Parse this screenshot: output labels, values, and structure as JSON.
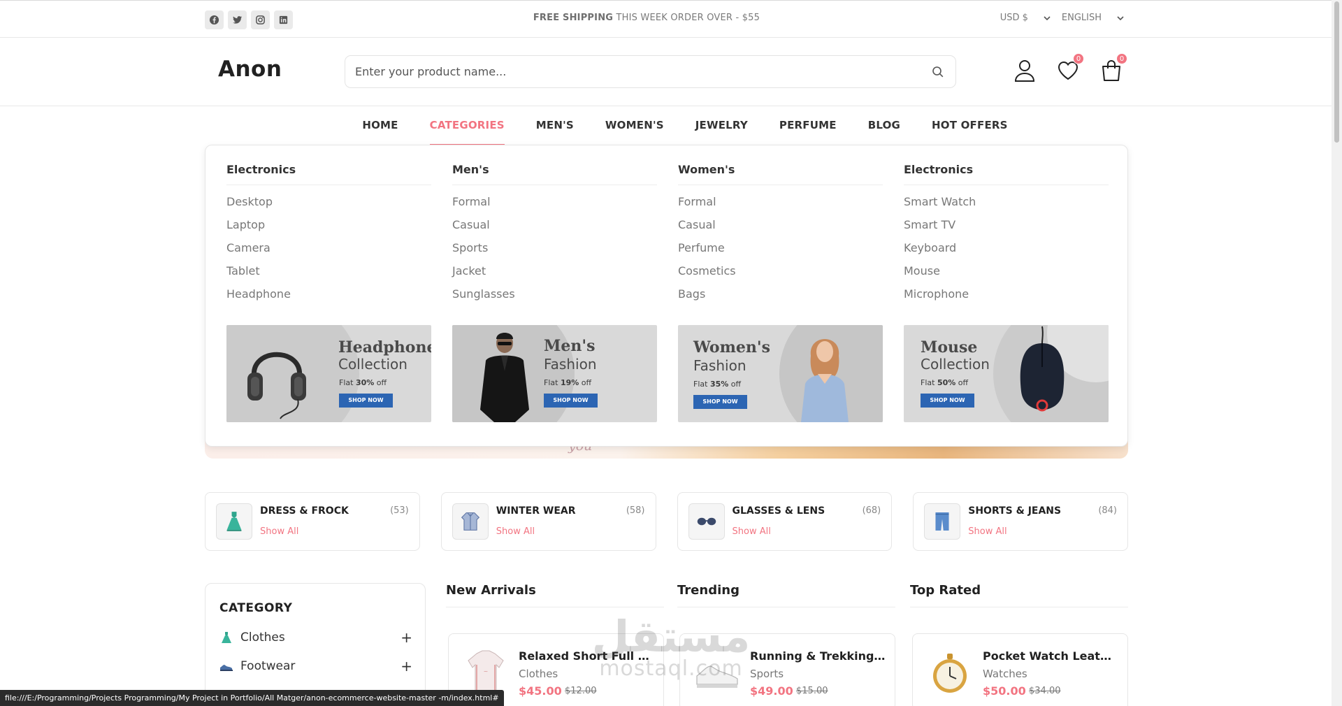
{
  "topbar": {
    "social_icons": [
      "facebook-icon",
      "twitter-icon",
      "instagram-icon",
      "linkedin-icon"
    ],
    "shipping_prefix": "FREE SHIPPING",
    "shipping_suffix": " THIS WEEK ORDER OVER - $55",
    "currency": "USD $",
    "language": "ENGLISH"
  },
  "header": {
    "logo": "Anon",
    "search_placeholder": "Enter your product name...",
    "wishlist_count": "0",
    "cart_count": "0"
  },
  "nav": {
    "items": [
      "HOME",
      "CATEGORIES",
      "MEN'S",
      "WOMEN'S",
      "JEWELRY",
      "PERFUME",
      "BLOG",
      "HOT OFFERS"
    ],
    "active": "CATEGORIES"
  },
  "dropdown": {
    "columns": [
      {
        "title": "Electronics",
        "links": [
          "Desktop",
          "Laptop",
          "Camera",
          "Tablet",
          "Headphone"
        ],
        "promo": {
          "title": "Headphone",
          "subtitle": "Collection",
          "flat_prefix": "Flat ",
          "discount": "30%",
          "flat_suffix": " off",
          "button": "SHOP NOW"
        }
      },
      {
        "title": "Men's",
        "links": [
          "Formal",
          "Casual",
          "Sports",
          "Jacket",
          "Sunglasses"
        ],
        "promo": {
          "title": "Men's",
          "subtitle": "Fashion",
          "flat_prefix": "Flat ",
          "discount": "19%",
          "flat_suffix": " off",
          "button": "SHOP NOW"
        }
      },
      {
        "title": "Women's",
        "links": [
          "Formal",
          "Casual",
          "Perfume",
          "Cosmetics",
          "Bags"
        ],
        "promo": {
          "title": "Women's",
          "subtitle": "Fashion",
          "flat_prefix": "Flat ",
          "discount": "35%",
          "flat_suffix": " off",
          "button": "SHOP NOW"
        }
      },
      {
        "title": "Electronics",
        "links": [
          "Smart Watch",
          "Smart TV",
          "Keyboard",
          "Mouse",
          "Microphone"
        ],
        "promo": {
          "title": "Mouse",
          "subtitle": "Collection",
          "flat_prefix": "Flat ",
          "discount": "50%",
          "flat_suffix": " off",
          "button": "SHOP NOW"
        }
      }
    ]
  },
  "banner_peek_text": "you",
  "categories": [
    {
      "name": "DRESS & FROCK",
      "count": "(53)",
      "link": "Show All",
      "icon": "dress-icon"
    },
    {
      "name": "WINTER WEAR",
      "count": "(58)",
      "link": "Show All",
      "icon": "jacket-icon"
    },
    {
      "name": "GLASSES & LENS",
      "count": "(68)",
      "link": "Show All",
      "icon": "glasses-icon"
    },
    {
      "name": "SHORTS & JEANS",
      "count": "(84)",
      "link": "Show All",
      "icon": "shorts-icon"
    }
  ],
  "sidebar": {
    "title": "CATEGORY",
    "items": [
      {
        "label": "Clothes",
        "icon": "dress-icon",
        "toggle": "+"
      },
      {
        "label": "Footwear",
        "icon": "shoe-icon",
        "toggle": "+"
      }
    ]
  },
  "product_sections": [
    {
      "title": "New Arrivals",
      "card": {
        "name": "Relaxed Short Full Sleeve T-Shirt",
        "category": "Clothes",
        "price": "$45.00",
        "old_price": "$12.00",
        "icon": "tshirt-icon"
      }
    },
    {
      "title": "Trending",
      "card": {
        "name": "Running & Trekking Shoes - White",
        "category": "Sports",
        "price": "$49.00",
        "old_price": "$15.00",
        "icon": "shoe-icon"
      }
    },
    {
      "title": "Top Rated",
      "card": {
        "name": "Pocket Watch Leather Pouch",
        "category": "Watches",
        "price": "$50.00",
        "old_price": "$34.00",
        "icon": "pocket-watch-icon"
      }
    }
  ],
  "status_bar": "file:///E:/Programming/Projects  Programming/My Project in Portfolio/All Matger/anon-ecommerce-website-master -m/index.html#",
  "watermark": {
    "arabic": "مستقل",
    "latin": "mostaql.com"
  },
  "colors": {
    "accent": "#f27481",
    "button_blue": "#2c65b3",
    "text_dark": "#212121"
  }
}
